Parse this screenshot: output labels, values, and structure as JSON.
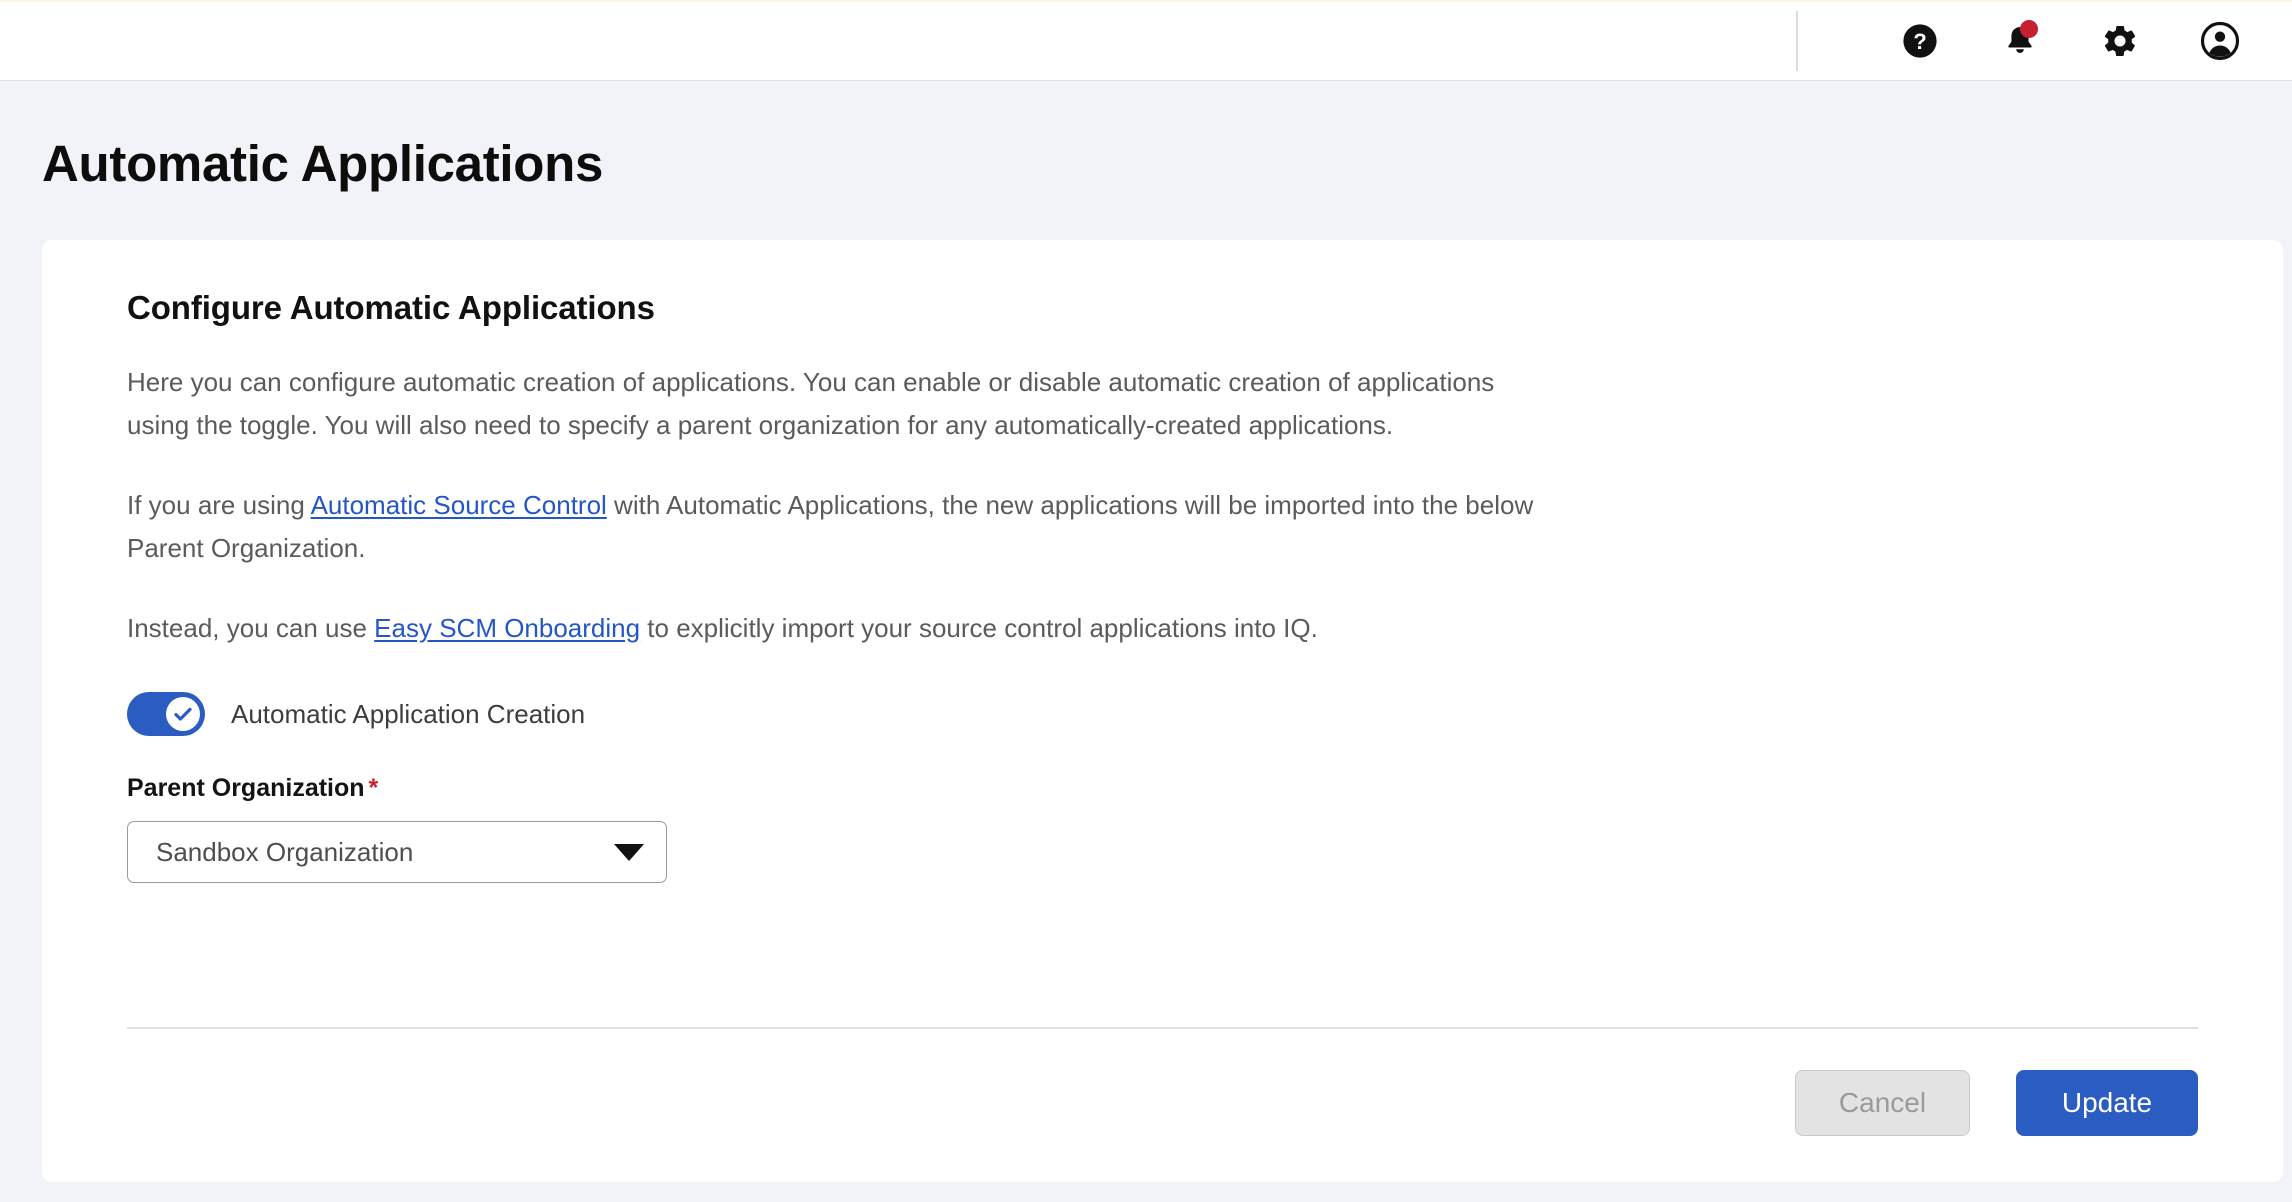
{
  "header": {
    "icons": [
      {
        "name": "help-icon",
        "label": "Help"
      },
      {
        "name": "notifications-icon",
        "label": "Notifications"
      },
      {
        "name": "gear-icon",
        "label": "Settings"
      },
      {
        "name": "account-icon",
        "label": "Account"
      }
    ],
    "notification_badge": true,
    "badge_color": "#c4202f"
  },
  "page": {
    "title": "Automatic Applications"
  },
  "card": {
    "heading": "Configure Automatic Applications",
    "paragraph1": "Here you can configure automatic creation of applications. You can enable or disable automatic creation of applications using the toggle. You will also need to specify a parent organization for any automatically-created applications.",
    "paragraph2": {
      "before": "If you are using ",
      "link": "Automatic Source Control",
      "after": " with Automatic Applications, the new applications will be imported into the below Parent Organization."
    },
    "paragraph3": {
      "before": "Instead, you can use ",
      "link": "Easy SCM Onboarding",
      "after": " to explicitly import your source control applications into IQ."
    },
    "toggle": {
      "label": "Automatic Application Creation",
      "checked": true,
      "on_color": "#2a5cc1"
    },
    "field": {
      "label": "Parent Organization",
      "required_marker": "*",
      "selected_value": "Sandbox Organization",
      "options": [
        "Sandbox Organization"
      ]
    },
    "buttons": {
      "cancel": "Cancel",
      "update": "Update",
      "cancel_disabled": true,
      "primary_color": "#2a5cc1"
    }
  },
  "colors": {
    "page_background": "#f2f3f9",
    "card_background": "#ffffff",
    "link": "#2457c5",
    "accent": "#2a5cc1",
    "required": "#c4202f"
  }
}
